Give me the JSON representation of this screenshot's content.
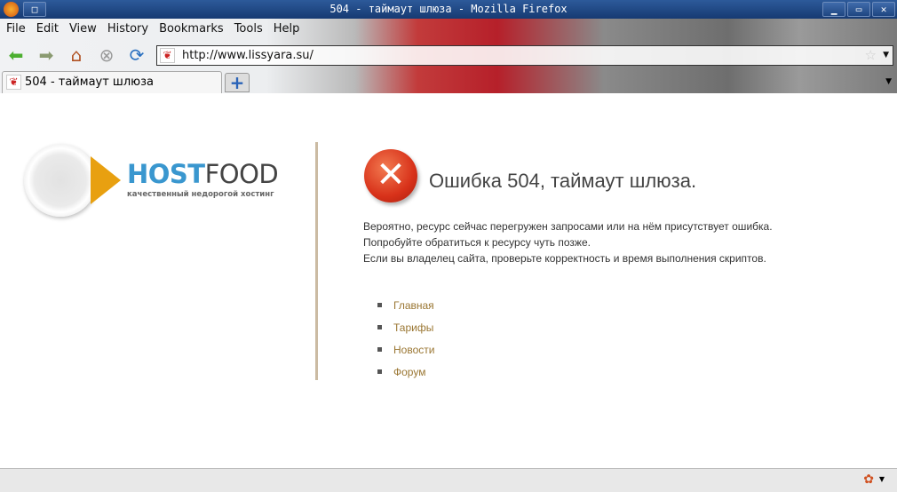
{
  "window": {
    "title": "504 - таймаут шлюза - Mozilla Firefox"
  },
  "menu": [
    "File",
    "Edit",
    "View",
    "History",
    "Bookmarks",
    "Tools",
    "Help"
  ],
  "toolbar": {
    "url": "http://www.lissyara.su/"
  },
  "tabs": [
    {
      "label": "504 - таймаут шлюза"
    }
  ],
  "logo": {
    "brand_bold": "HOST",
    "brand_light": "FOOD",
    "tagline": "качественный недорогой хостинг"
  },
  "error": {
    "heading": "Ошибка 504, таймаут шлюза.",
    "lines": [
      "Вероятно, ресурс сейчас перегружен запросами или на нём присутствует ошибка.",
      "Попробуйте обратиться к ресурсу чуть позже.",
      "Если вы владелец сайта, проверьте корректность и время выполнения скриптов."
    ]
  },
  "links": [
    "Главная",
    "Тарифы",
    "Новости",
    "Форум"
  ],
  "colors": {
    "link": "#9a7632",
    "brand_blue": "#3a97cf",
    "titlebar": "#1f4681"
  }
}
